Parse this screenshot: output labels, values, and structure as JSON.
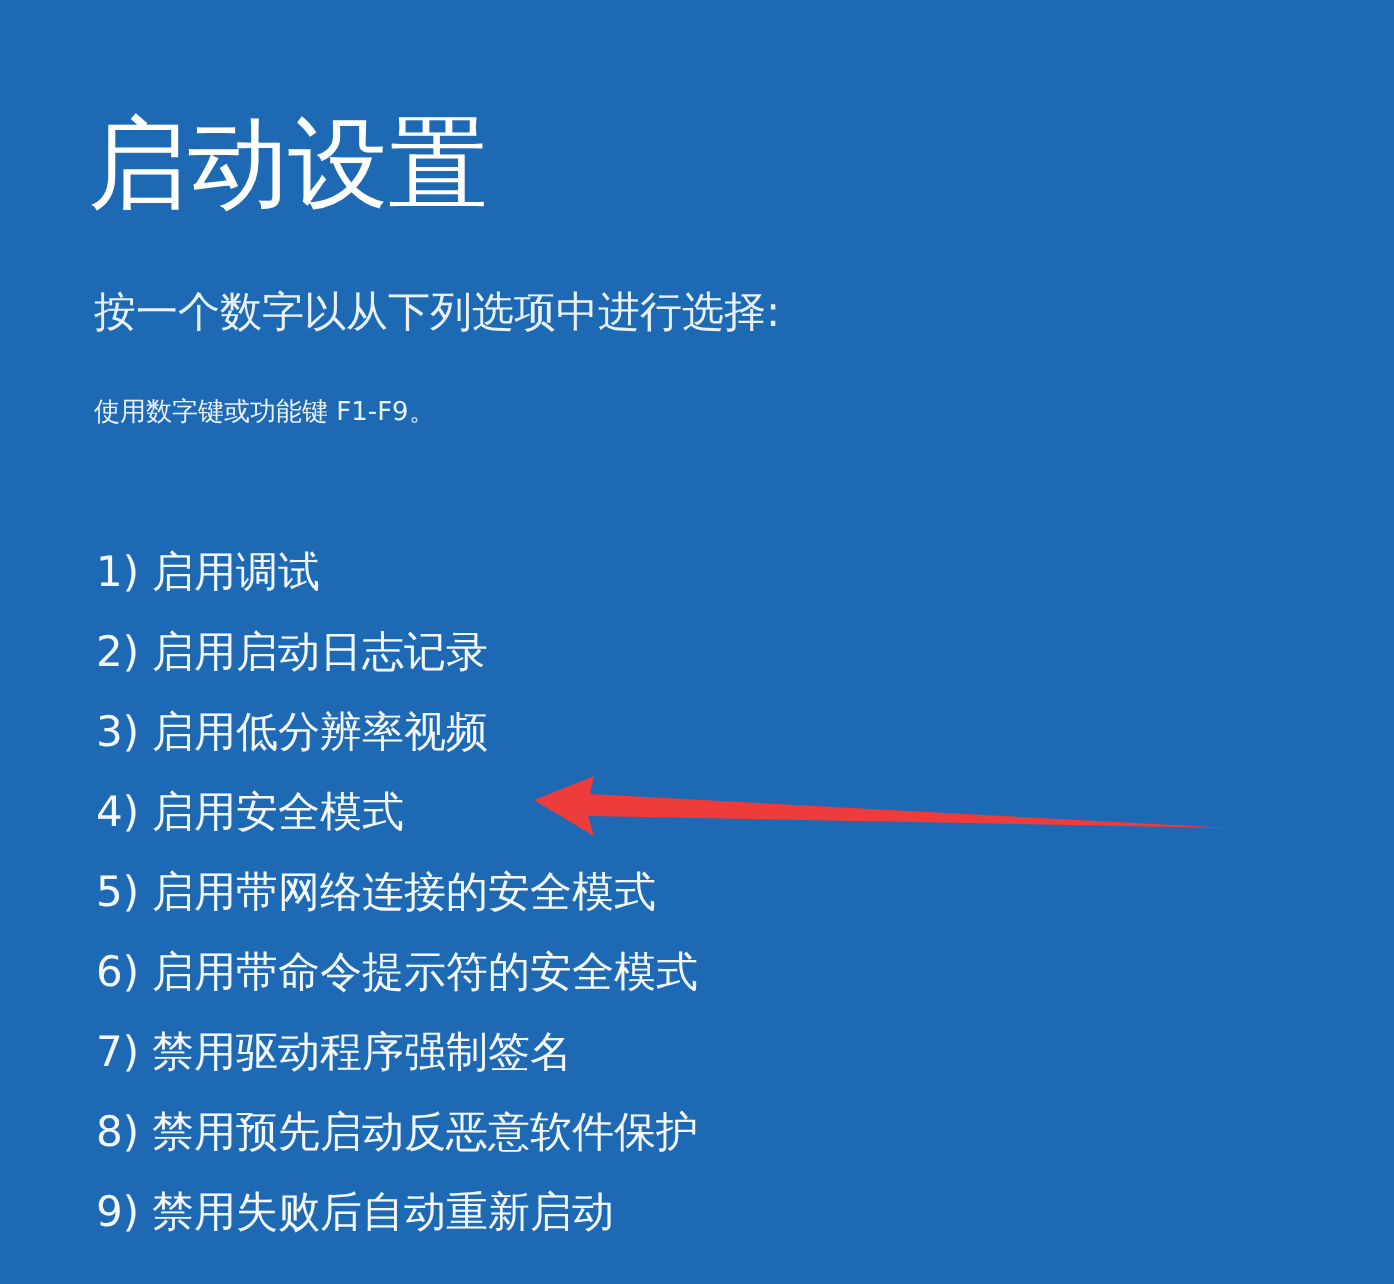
{
  "title": "启动设置",
  "subtitle": "按一个数字以从下列选项中进行选择:",
  "hint": "使用数字键或功能键 F1-F9。",
  "options": [
    {
      "label": "1) 启用调试",
      "pointed": false
    },
    {
      "label": "2) 启用启动日志记录",
      "pointed": false
    },
    {
      "label": "3) 启用低分辨率视频",
      "pointed": false
    },
    {
      "label": "4) 启用安全模式",
      "pointed": true
    },
    {
      "label": "5) 启用带网络连接的安全模式",
      "pointed": false
    },
    {
      "label": "6) 启用带命令提示符的安全模式",
      "pointed": false
    },
    {
      "label": "7) 禁用驱动程序强制签名",
      "pointed": false
    },
    {
      "label": "8) 禁用预先启动反恶意软件保护",
      "pointed": false
    },
    {
      "label": "9) 禁用失败后自动重新启动",
      "pointed": false
    }
  ]
}
